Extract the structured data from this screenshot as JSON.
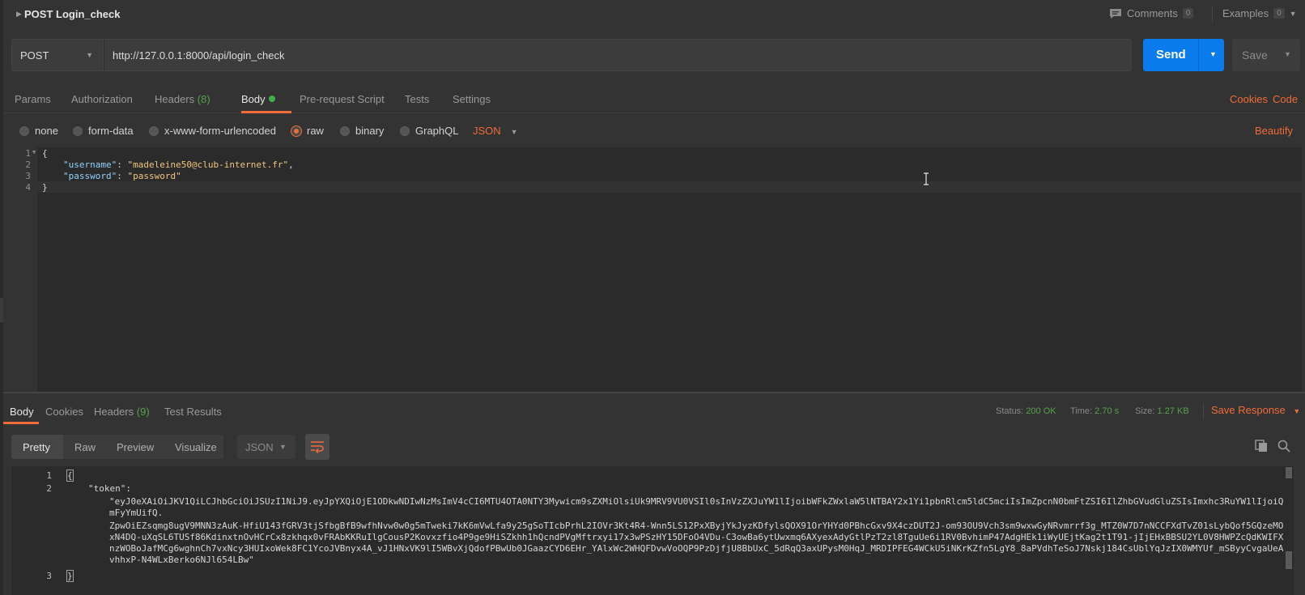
{
  "header": {
    "title": "POST Login_check",
    "comments_label": "Comments",
    "comments_count": "0",
    "examples_label": "Examples",
    "examples_count": "0"
  },
  "request": {
    "method": "POST",
    "url": "http://127.0.0.1:8000/api/login_check",
    "send_label": "Send",
    "save_label": "Save"
  },
  "tabs": {
    "params": "Params",
    "authorization": "Authorization",
    "headers": "Headers",
    "headers_count": "(8)",
    "body": "Body",
    "prerequest": "Pre-request Script",
    "tests": "Tests",
    "settings": "Settings",
    "cookies": "Cookies",
    "code": "Code"
  },
  "body_types": {
    "none": "none",
    "form_data": "form-data",
    "urlencoded": "x-www-form-urlencoded",
    "raw": "raw",
    "binary": "binary",
    "graphql": "GraphQL",
    "format": "JSON",
    "beautify": "Beautify"
  },
  "request_body": {
    "line_numbers": [
      "1",
      "2",
      "3",
      "4"
    ],
    "open_brace": "{",
    "username_key": "\"username\"",
    "username_value": "\"madeleine50@club-internet.fr\"",
    "password_key": "\"password\"",
    "password_value": "\"password\"",
    "close_brace": "}"
  },
  "response": {
    "tabs": {
      "body": "Body",
      "cookies": "Cookies",
      "headers": "Headers",
      "headers_count": "(9)",
      "test_results": "Test Results"
    },
    "status_label": "Status:",
    "status_value": "200 OK",
    "time_label": "Time:",
    "time_value": "2.70 s",
    "size_label": "Size:",
    "size_value": "1.27 KB",
    "save_response": "Save Response",
    "views": {
      "pretty": "Pretty",
      "raw": "Raw",
      "preview": "Preview",
      "visualize": "Visualize",
      "format": "JSON"
    },
    "line_numbers": [
      "1",
      "2",
      "3"
    ],
    "open_brace": "{",
    "token_key": "\"token\"",
    "token_lines": [
      "\"eyJ0eXAiOiJKV1QiLCJhbGciOiJSUzI1NiJ9.eyJpYXQiOjE1ODkwNDIwNzMsImV4cCI6MTU4OTA0NTY3Mywicm9sZXMiOlsiUk9MRV9VU0VSIl0sInVzZXJuYW1lIjoibWFkZWxlaW5lNTBAY2x1Yi1pbnRlcm5ldC5mciIsImZpcnN0bmFtZSI6IlZhbGVudGluZSIsImxhc3RuYW1lIjoiQ",
      "mFyYmUifQ.",
      "ZpwOiEZsqmg8ugV9MNN3zAuK-HfiU143fGRV3tjSfbgBfB9wfhNvw0w0g5mTweki7kK6mVwLfa9y25gSoTIcbPrhL2IOVr3Kt4R4-Wnn5LS12PxXByjYkJyzKDfylsQOX91OrYHYd0PBhcGxv9X4czDUT2J-om93OU9Vch3sm9wxwGyNRvmrrf3g_MTZ0W7D7nNCCFXdTvZ01sLybQof5GQzeMO",
      "xN4DQ-uXqSL6TUSf86KdinxtnOvHCrCx8zkhqx0vFRAbKKRuIlgCousP2Kovxzfio4P9ge9HiSZkhh1hQcndPVgMftrxyi17x3wPSzHY15DFoO4VDu-C3owBa6ytUwxmq6AXyexAdyGtlPzT2zl8TguUe6i1RV0BvhimP47AdgHEk1iWyUEjtKag2t1T91-jIjEHxBBSU2YL0V8HWPZcQdKWIFX",
      "nzWOBoJafMCg6wghnCh7vxNcy3HUIxoWek8FC1YcoJVBnyx4A_vJ1HNxVK9lI5WBvXjQdofPBwUb0JGaazCYD6EHr_YAlxWc2WHQFDvwVoOQP9PzDjfjU8BbUxC_5dRqQ3axUPysM0HqJ_MRDIPFEG4WCkU5iNKrKZfn5LgY8_8aPVdhTeSoJ7Nskj184CsUblYqJzIX0WMYUf_mSByyCvgaUeA",
      "vhhxP-N4WLxBerko6NJl654LBw\""
    ],
    "close_brace": "}"
  }
}
